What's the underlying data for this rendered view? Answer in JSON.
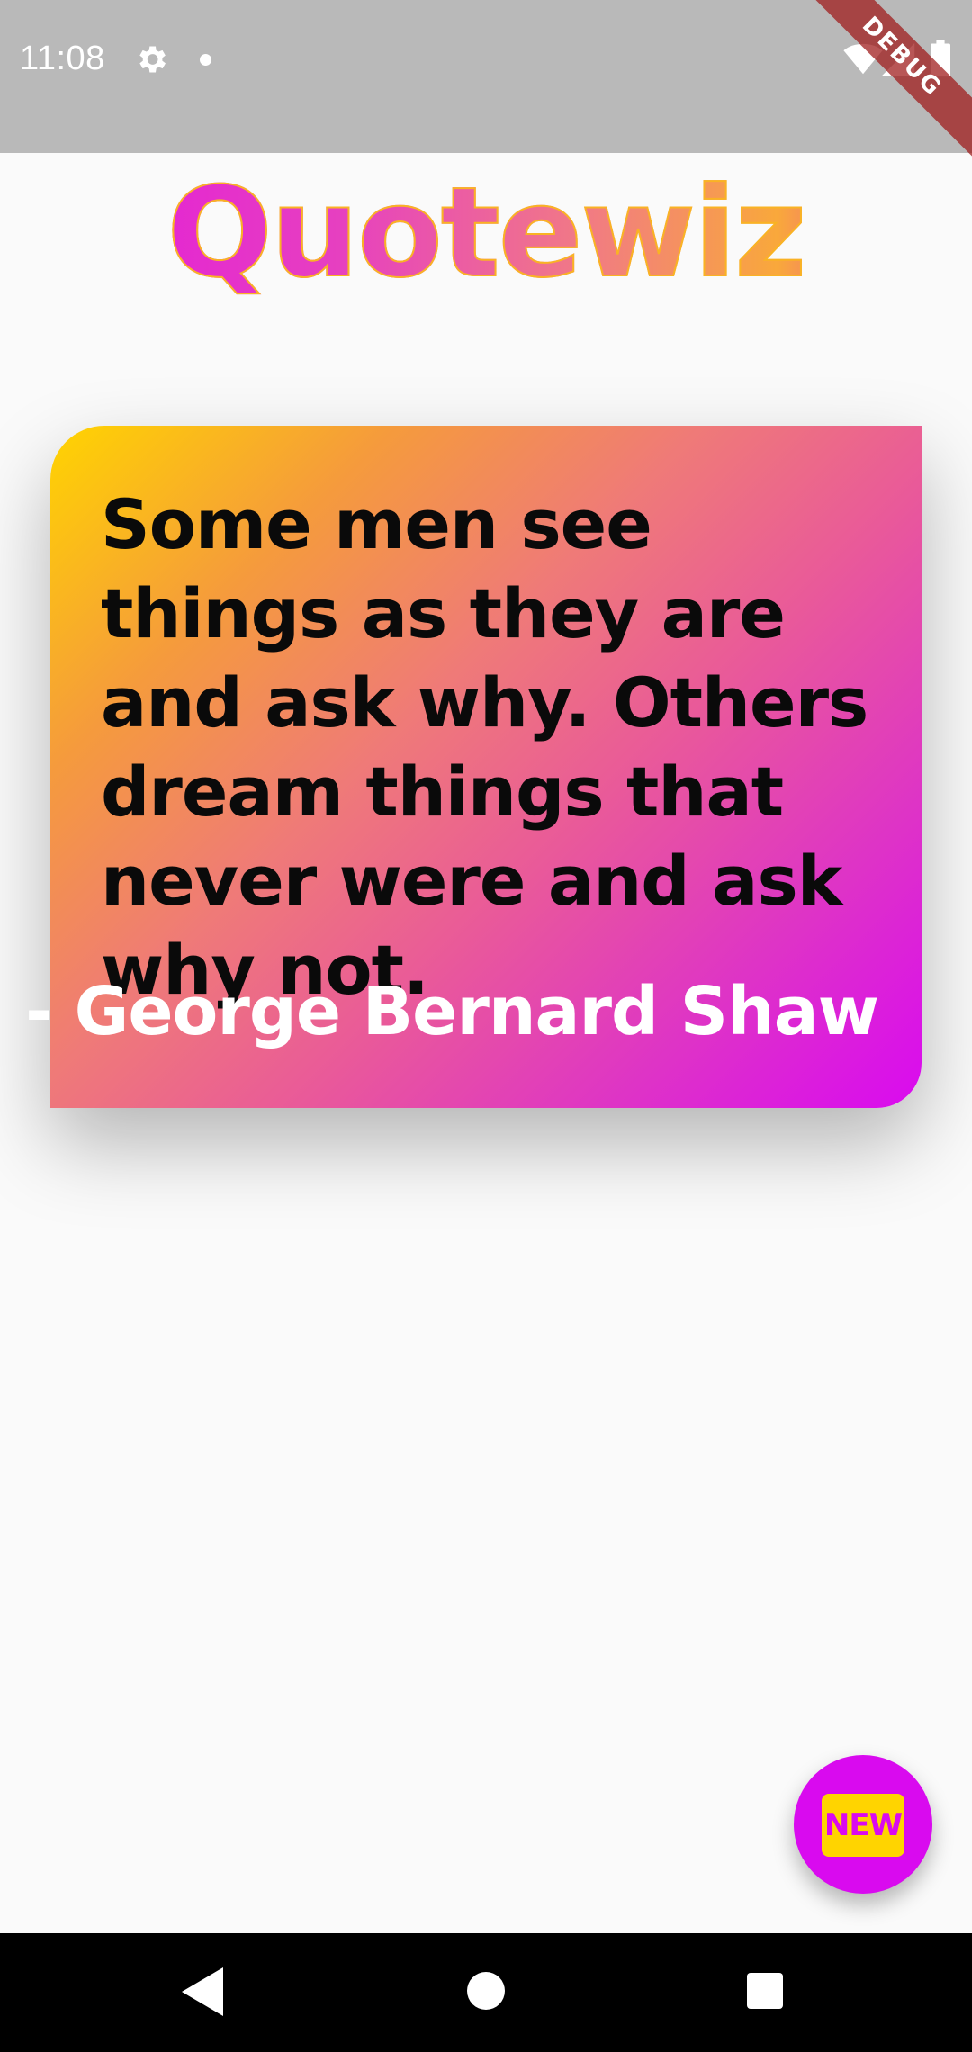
{
  "status_bar": {
    "time": "11:08",
    "icons": [
      "gear-icon",
      "notification-dot-icon",
      "wifi-icon",
      "signal-icon",
      "battery-icon"
    ]
  },
  "debug_banner": {
    "label": "DEBUG",
    "color": "#a01e1e"
  },
  "app": {
    "title": "Quotewiz"
  },
  "quote": {
    "text": "Some men see things as they are and ask why. Others dream things that never were and ask why not.",
    "author": "- George Bernard Shaw",
    "gradient_colors": [
      "#ffd400",
      "#ef7a78",
      "#d90af0"
    ]
  },
  "fab": {
    "label": "NEW",
    "background": "#d90aef",
    "badge_color": "#ffd400"
  },
  "nav_bar": {
    "buttons": [
      "back-icon",
      "home-icon",
      "recents-icon"
    ]
  }
}
